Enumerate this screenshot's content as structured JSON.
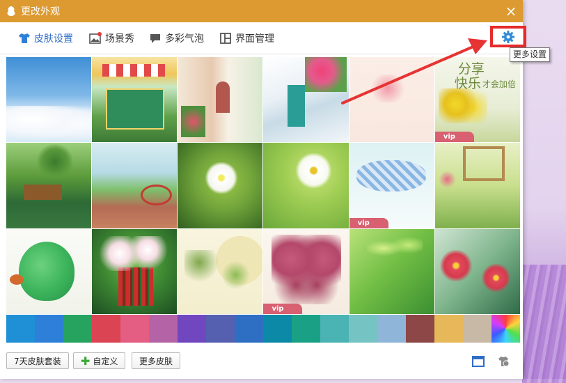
{
  "window": {
    "title": "更改外观",
    "close_symbol": "×"
  },
  "tabs": [
    {
      "label": "皮肤设置",
      "icon": "tshirt-icon",
      "active": true
    },
    {
      "label": "场景秀",
      "icon": "picture-icon",
      "active": false
    },
    {
      "label": "多彩气泡",
      "icon": "chat-bubble-icon",
      "active": false
    },
    {
      "label": "界面管理",
      "icon": "layout-icon",
      "active": false
    }
  ],
  "settings": {
    "icon": "gear-icon",
    "tooltip": "更多设置"
  },
  "skins": {
    "vip_label": "vip",
    "tile_text_1": "分享",
    "tile_text_2": "快乐",
    "tile_text_3": "才会加倍"
  },
  "swatches": [
    "#1f8fd6",
    "#2d7fd8",
    "#25a35f",
    "#db4453",
    "#e45d82",
    "#b464a6",
    "#7147c0",
    "#5560b0",
    "#2f6fc3",
    "#0c89a6",
    "#1aa185",
    "#4ab3b3",
    "#76c3c3",
    "#8fb5d8",
    "#8d4747",
    "#e6b85a",
    "#c8b8a6",
    "#rainbow"
  ],
  "bottom": {
    "btn_suit": "7天皮肤套装",
    "btn_custom": "自定义",
    "btn_more": "更多皮肤",
    "icon_window": "window-mode-icon",
    "icon_theme": "theme-tool-icon"
  },
  "colors": {
    "titlebar": "#dc9a31",
    "accent": "#2f6dc6",
    "highlight": "#e62b2b"
  }
}
